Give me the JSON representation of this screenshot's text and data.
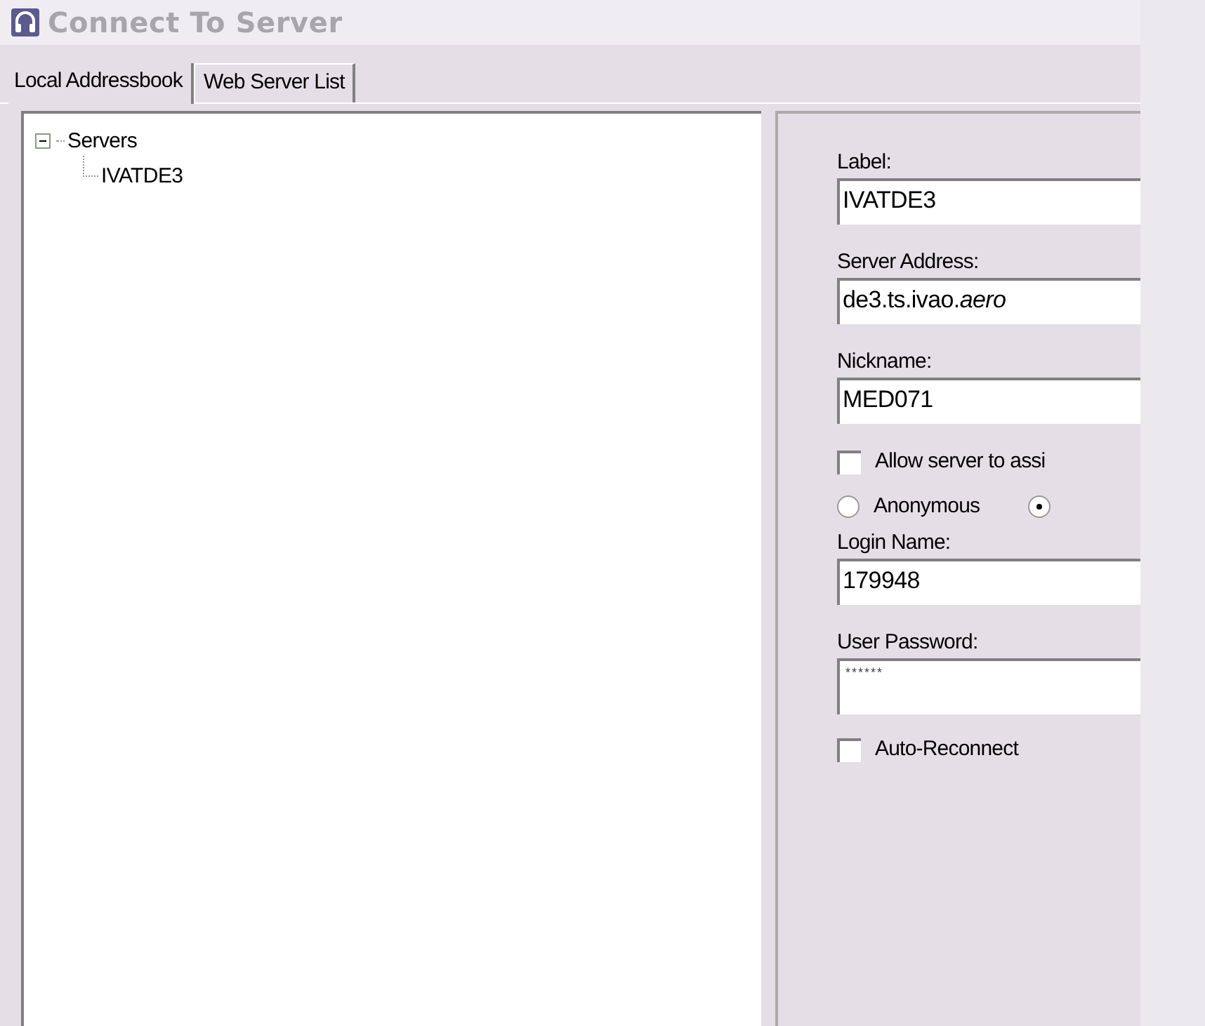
{
  "window": {
    "title": "Connect To Server"
  },
  "tabs": [
    {
      "label": "Local Addressbook",
      "selected": true
    },
    {
      "label": "Web Server List",
      "selected": false
    }
  ],
  "tree": [
    {
      "label": "Servers",
      "expanded": true,
      "children": [
        {
          "label": "IVATDE3"
        }
      ]
    }
  ],
  "form": {
    "fields": [
      {
        "label": "Label:",
        "value": "IVATDE3"
      },
      {
        "label": "Server Address:",
        "value": "de3.ts.ivao.*aero*"
      },
      {
        "label": "Nickname:",
        "value": "MED071"
      }
    ],
    "assign_checkbox": {
      "label": "Allow server to assi",
      "checked": false
    },
    "login_mode": [
      {
        "label": "Anonymous",
        "selected": false
      },
      {
        "selected": true
      }
    ],
    "login_fields": [
      {
        "label": "Login Name:",
        "value": "179948",
        "kind": "text"
      },
      {
        "label": "User Password:",
        "value": "******",
        "kind": "password"
      }
    ],
    "reconnect_checkbox": {
      "label": "Auto-Reconnect",
      "checked": false
    }
  }
}
